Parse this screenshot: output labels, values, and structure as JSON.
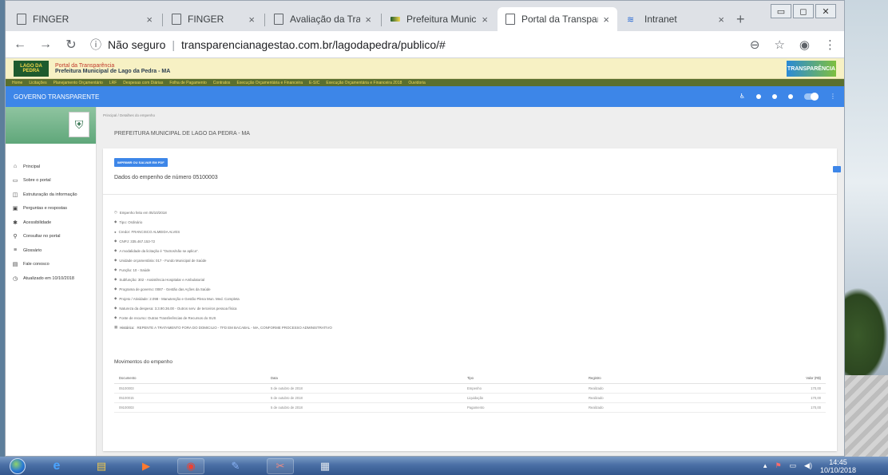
{
  "browser": {
    "tabs": [
      {
        "title": "FINGER",
        "active": false
      },
      {
        "title": "FINGER",
        "active": false
      },
      {
        "title": "Avaliação da Transparê",
        "active": false
      },
      {
        "title": "Prefeitura Municipal de",
        "active": false
      },
      {
        "title": "Portal da Transparência",
        "active": true
      },
      {
        "title": "Intranet",
        "active": false
      }
    ],
    "security_label": "Não seguro",
    "url": "transparencianagestao.com.br/lagodapedra/publico/#",
    "close_glyph": "×",
    "new_tab_glyph": "+"
  },
  "site_header": {
    "logo_text": "LAGO DA PEDRA",
    "portal_label": "Portal da Transparência",
    "prefeitura_label": "Prefeitura Municipal de Lago da Pedra - MA",
    "tp_logo_text": "TRANSPARÊNCIA"
  },
  "menu": [
    "Home",
    "Licitações",
    "Planejamento Orçamentário",
    "LRF",
    "Despesas com Diárias",
    "Folha de Pagamento",
    "Contratos",
    "Execução Orçamentária e Financeira",
    "E-SIC",
    "Execução Orçamentária e Financeira 2018",
    "Ouvidoria"
  ],
  "govbar": {
    "title": "GOVERNO TRANSPARENTE"
  },
  "sidebar": {
    "items": [
      {
        "label": "Principal",
        "icon": "home-icon"
      },
      {
        "label": "Sobre o portal",
        "icon": "folder-icon"
      },
      {
        "label": "Estruturação da informação",
        "icon": "layers-icon"
      },
      {
        "label": "Perguntas e respostas",
        "icon": "question-icon"
      },
      {
        "label": "Acessibilidade",
        "icon": "accessibility-icon"
      },
      {
        "label": "Consultar no portal",
        "icon": "search-icon"
      },
      {
        "label": "Glossário",
        "icon": "list-icon"
      },
      {
        "label": "Fale conosco",
        "icon": "chat-icon"
      },
      {
        "label": "Atualizado em 10/10/2018",
        "icon": "clock-icon"
      }
    ]
  },
  "main": {
    "breadcrumb": "Principal / Detalhes do empenho",
    "page_title": "PREFEITURA MUNICIPAL DE LAGO DA PEDRA - MA",
    "print_button": "IMPRIMIR OU SALVAR EM PDF",
    "heading": "Dados do empenho de número 05100003",
    "details": [
      "Empenho feito em 05/10/2018",
      "Tipo: Ordinário",
      "Credor: FRANCISCO ALMEIDA ALVES",
      "CNPJ: 335.467.153-72",
      "A modalidade da licitação é \"Outros/não se aplica\".",
      "Unidade orçamentária: 017 - Fundo Municipal de Saúde",
      "Função: 10 - Saúde",
      "Subfunção: 302 - Assistência Hospitalar e Ambulatorial",
      "Programa de governo: 0087 - Gestão das Ações da Saúde",
      "Projeto / Atividade: 2.098 - Manutenção e Gestão Plena Mun. Med. Completa",
      "Natureza da despesa: 3.3.90.36.00 - Outros serv. de terceiros pessoa física",
      "Fonte de recurso: Outras Transferências de Recursos do SUS"
    ],
    "historico_label": "Histórico:",
    "historico_value": "REPENTE A TRATAMENTO FORA DO DOMICILIO - TFD EM BACABAL - MA, CONFORME PROCESSO ADMINISTRATIVO",
    "movements_title": "Movimentos do empenho",
    "table": {
      "headers": [
        "Documento",
        "Data",
        "Tipo",
        "Registro",
        "Valor (R$)"
      ],
      "rows": [
        [
          "05100003",
          "5 de outubro de 2018",
          "Empenho",
          "Realizado",
          "170,00"
        ],
        [
          "05100015",
          "5 de outubro de 2018",
          "Liquidação",
          "Realizado",
          "170,00"
        ],
        [
          "09100003",
          "5 de outubro de 2018",
          "Pagamento",
          "Realizado",
          "170,00"
        ]
      ]
    }
  },
  "taskbar": {
    "time": "14:45",
    "date": "10/10/2018"
  }
}
